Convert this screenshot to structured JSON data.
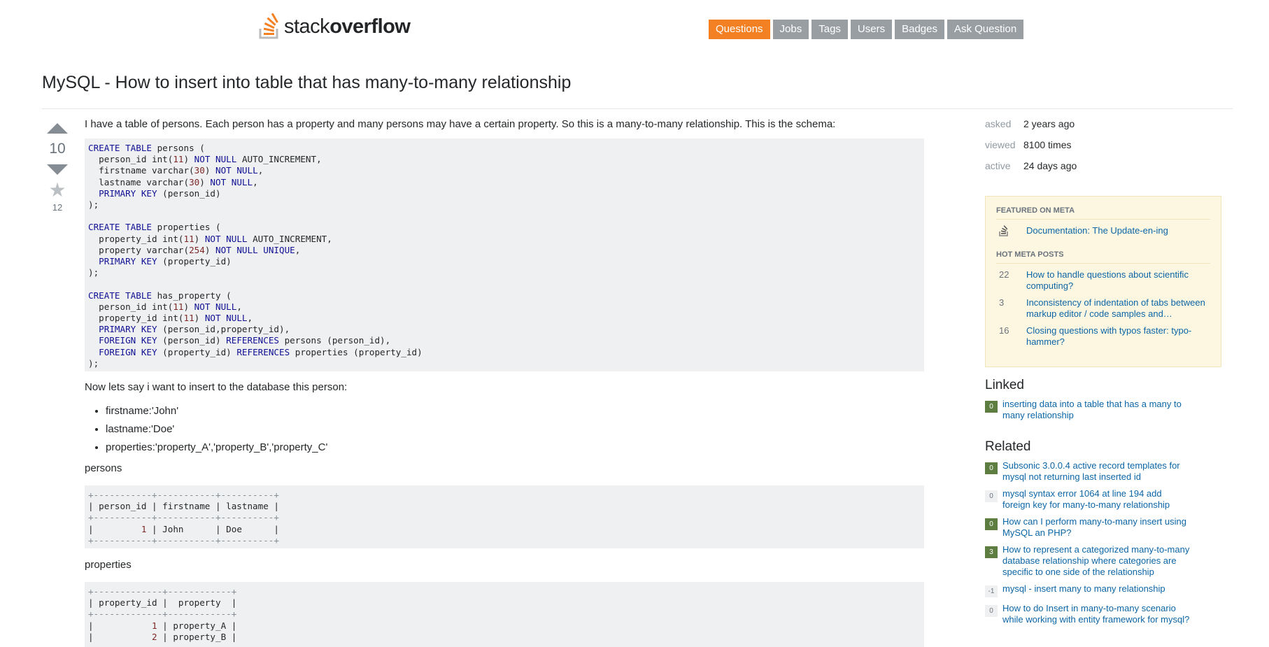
{
  "header": {
    "logo_light": "stack",
    "logo_bold": "overflow",
    "nav": [
      "Questions",
      "Jobs",
      "Tags",
      "Users",
      "Badges",
      "Ask Question"
    ],
    "active_nav": "Questions",
    "accent_color": "#f48024"
  },
  "question": {
    "title": "MySQL - How to insert into table that has many-to-many relationship",
    "vote_count": "10",
    "favorite_count": "12",
    "intro": "I have a table of persons. Each person has a property and many persons may have a certain property. So this is a many-to-many relationship. This is the schema:",
    "schema_code": "CREATE TABLE persons (\n  person_id int(11) NOT NULL AUTO_INCREMENT,\n  firstname varchar(30) NOT NULL,\n  lastname varchar(30) NOT NULL,\n  PRIMARY KEY (person_id)\n);\n\nCREATE TABLE properties (\n  property_id int(11) NOT NULL AUTO_INCREMENT,\n  property varchar(254) NOT NULL UNIQUE,\n  PRIMARY KEY (property_id)\n);\n\nCREATE TABLE has_property (\n  person_id int(11) NOT NULL,\n  property_id int(11) NOT NULL,\n  PRIMARY KEY (person_id,property_id),\n  FOREIGN KEY (person_id) REFERENCES persons (person_id),\n  FOREIGN KEY (property_id) REFERENCES properties (property_id)\n);",
    "insert_text": "Now lets say i want to insert to the database this person:",
    "person_fields": [
      "firstname:'John'",
      "lastname:'Doe'",
      "properties:'property_A','property_B','property_C'"
    ],
    "persons_label": "persons",
    "persons_table": "+-----------+-----------+----------+\n| person_id | firstname | lastname |\n+-----------+-----------+----------+\n|         1 | John      | Doe      |\n+-----------+-----------+----------+",
    "properties_label": "properties",
    "properties_table": "+-------------+------------+\n| property_id |  property  |\n+-------------+------------+\n|           1 | property_A |\n|           2 | property_B |"
  },
  "stats": [
    {
      "label": "asked",
      "value": "2 years ago"
    },
    {
      "label": "viewed",
      "value": "8100 times"
    },
    {
      "label": "active",
      "value": "24 days ago"
    }
  ],
  "meta": {
    "featured_heading": "FEATURED ON META",
    "featured": [
      {
        "icon": "stackexchange-icon",
        "title": "Documentation: The Update-en-ing"
      }
    ],
    "hot_heading": "HOT META POSTS",
    "hot": [
      {
        "count": "22",
        "title": "How to handle questions about scientific computing?"
      },
      {
        "count": "3",
        "title": "Inconsistency of indentation of tabs between markup editor / code samples and…"
      },
      {
        "count": "16",
        "title": "Closing questions with typos faster: typo-hammer?"
      }
    ]
  },
  "linked": {
    "heading": "Linked",
    "items": [
      {
        "score": "0",
        "answered": true,
        "title": "inserting data into a table that has a many to many relationship"
      }
    ]
  },
  "related": {
    "heading": "Related",
    "items": [
      {
        "score": "0",
        "answered": true,
        "title": "Subsonic 3.0.0.4 active record templates for mysql not returning last inserted id"
      },
      {
        "score": "0",
        "answered": false,
        "title": "mysql syntax error 1064 at line 194 add foreign key for many-to-many relationship"
      },
      {
        "score": "0",
        "answered": true,
        "title": "How can I perform many-to-many insert using MySQL an PHP?"
      },
      {
        "score": "3",
        "answered": true,
        "title": "How to represent a categorized many-to-many database relationship where categories are specific to one side of the relationship"
      },
      {
        "score": "-1",
        "answered": false,
        "title": "mysql - insert many to many relationship"
      },
      {
        "score": "0",
        "answered": false,
        "title": "How to do Insert in many-to-many scenario while working with entity framework for mysql?"
      }
    ]
  }
}
